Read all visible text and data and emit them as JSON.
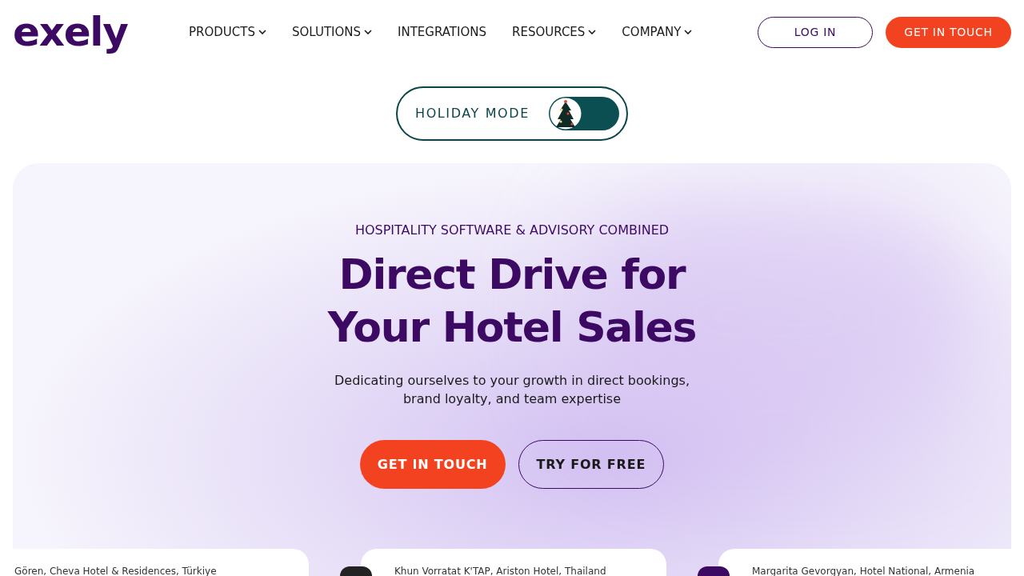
{
  "header": {
    "logo": "exely",
    "nav": [
      {
        "label": "PRODUCTS",
        "dropdown": true
      },
      {
        "label": "SOLUTIONS",
        "dropdown": true
      },
      {
        "label": "INTEGRATIONS",
        "dropdown": false
      },
      {
        "label": "RESOURCES",
        "dropdown": true
      },
      {
        "label": "COMPANY",
        "dropdown": true
      }
    ],
    "login": "LOG IN",
    "contact": "GET IN TOUCH"
  },
  "holiday_toggle": {
    "label": "HOLIDAY MODE",
    "on": true
  },
  "hero": {
    "eyebrow": "HOSPITALITY SOFTWARE & ADVISORY COMBINED",
    "title_lines": [
      "Direct Drive for",
      "Your Hotel Sales"
    ],
    "subtitle_lines": [
      "Dedicating ourselves to your growth in direct bookings,",
      "brand loyalty, and team expertise"
    ],
    "primary_button": "GET IN TOUCH",
    "secondary_button": "TRY FOR FREE"
  },
  "testimonials": [
    {
      "author": "Gören, Cheva Hotel & Residences, Türkiye",
      "avatar": false
    },
    {
      "author": "Khun Vorratat K'TAP, Ariston Hotel, Thailand",
      "avatar": true
    },
    {
      "author": "Margarita Gevorgyan, Hotel National, Armenia",
      "avatar": true
    }
  ]
}
